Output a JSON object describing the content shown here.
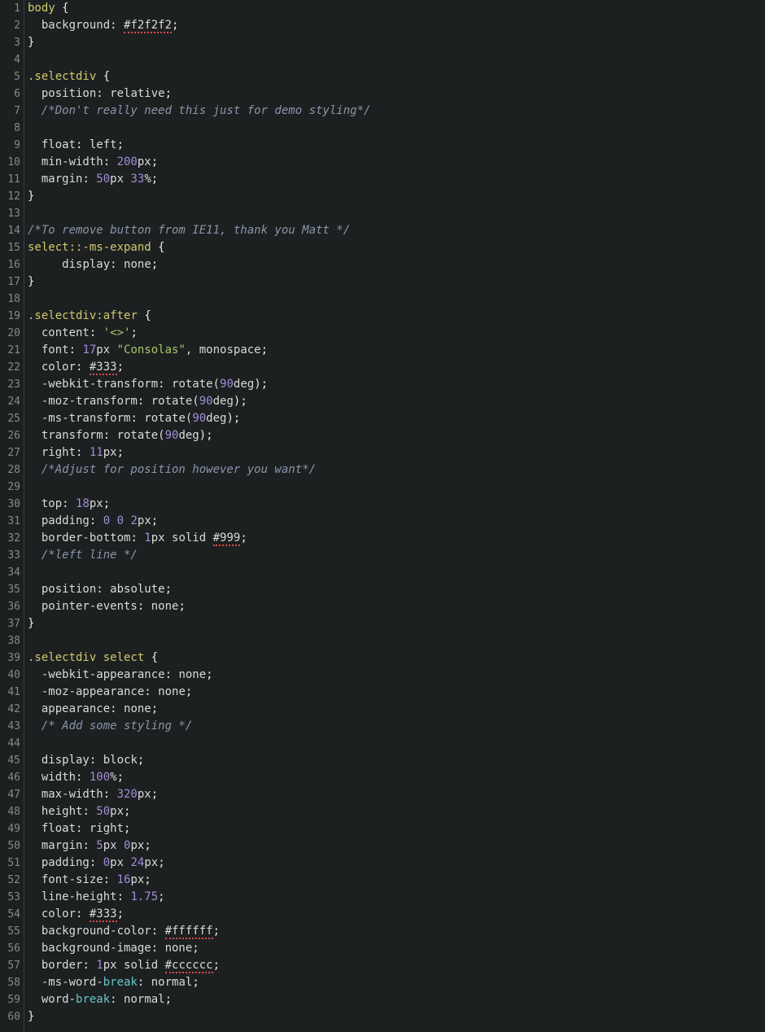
{
  "lines": [
    {
      "n": 1,
      "tokens": [
        {
          "t": "body ",
          "c": "sel"
        },
        {
          "t": "{",
          "c": "brace"
        }
      ]
    },
    {
      "n": 2,
      "tokens": [
        {
          "t": "  ",
          "c": ""
        },
        {
          "t": "background",
          "c": "prop"
        },
        {
          "t": ": ",
          "c": "punct"
        },
        {
          "t": "#f2f2f2",
          "c": "val",
          "u": true
        },
        {
          "t": ";",
          "c": "punct"
        }
      ]
    },
    {
      "n": 3,
      "tokens": [
        {
          "t": "}",
          "c": "brace"
        }
      ]
    },
    {
      "n": 4,
      "tokens": []
    },
    {
      "n": 5,
      "tokens": [
        {
          "t": ".selectdiv ",
          "c": "sel"
        },
        {
          "t": "{",
          "c": "brace"
        }
      ]
    },
    {
      "n": 6,
      "tokens": [
        {
          "t": "  ",
          "c": ""
        },
        {
          "t": "position",
          "c": "prop"
        },
        {
          "t": ": ",
          "c": "punct"
        },
        {
          "t": "relative",
          "c": "val"
        },
        {
          "t": ";",
          "c": "punct"
        }
      ]
    },
    {
      "n": 7,
      "tokens": [
        {
          "t": "  ",
          "c": ""
        },
        {
          "t": "/*Don't really need this just for demo styling*/",
          "c": "comment"
        }
      ]
    },
    {
      "n": 8,
      "tokens": [
        {
          "t": "  ",
          "c": ""
        }
      ]
    },
    {
      "n": 9,
      "tokens": [
        {
          "t": "  ",
          "c": ""
        },
        {
          "t": "float",
          "c": "prop"
        },
        {
          "t": ": ",
          "c": "punct"
        },
        {
          "t": "left",
          "c": "val"
        },
        {
          "t": ";",
          "c": "punct"
        }
      ]
    },
    {
      "n": 10,
      "tokens": [
        {
          "t": "  ",
          "c": ""
        },
        {
          "t": "min-width",
          "c": "prop"
        },
        {
          "t": ": ",
          "c": "punct"
        },
        {
          "t": "200",
          "c": "num"
        },
        {
          "t": "px",
          "c": "unit"
        },
        {
          "t": ";",
          "c": "punct"
        }
      ]
    },
    {
      "n": 11,
      "tokens": [
        {
          "t": "  ",
          "c": ""
        },
        {
          "t": "margin",
          "c": "prop"
        },
        {
          "t": ": ",
          "c": "punct"
        },
        {
          "t": "50",
          "c": "num"
        },
        {
          "t": "px ",
          "c": "unit"
        },
        {
          "t": "33",
          "c": "num"
        },
        {
          "t": "%",
          "c": "unit"
        },
        {
          "t": ";",
          "c": "punct"
        }
      ]
    },
    {
      "n": 12,
      "tokens": [
        {
          "t": "}",
          "c": "brace"
        }
      ]
    },
    {
      "n": 13,
      "tokens": []
    },
    {
      "n": 14,
      "tokens": [
        {
          "t": "/*To remove button from IE11, thank you Matt */",
          "c": "comment"
        }
      ]
    },
    {
      "n": 15,
      "tokens": [
        {
          "t": "select",
          "c": "sel"
        },
        {
          "t": "::-ms-expand ",
          "c": "sel"
        },
        {
          "t": "{",
          "c": "brace"
        }
      ]
    },
    {
      "n": 16,
      "tokens": [
        {
          "t": "     ",
          "c": ""
        },
        {
          "t": "display",
          "c": "prop"
        },
        {
          "t": ": ",
          "c": "punct"
        },
        {
          "t": "none",
          "c": "val"
        },
        {
          "t": ";",
          "c": "punct"
        }
      ]
    },
    {
      "n": 17,
      "tokens": [
        {
          "t": "}",
          "c": "brace"
        }
      ]
    },
    {
      "n": 18,
      "tokens": []
    },
    {
      "n": 19,
      "tokens": [
        {
          "t": ".selectdiv",
          "c": "sel"
        },
        {
          "t": ":after ",
          "c": "sel"
        },
        {
          "t": "{",
          "c": "brace"
        }
      ]
    },
    {
      "n": 20,
      "tokens": [
        {
          "t": "  ",
          "c": ""
        },
        {
          "t": "content",
          "c": "prop"
        },
        {
          "t": ": ",
          "c": "punct"
        },
        {
          "t": "'<>'",
          "c": "str"
        },
        {
          "t": ";",
          "c": "punct"
        }
      ]
    },
    {
      "n": 21,
      "tokens": [
        {
          "t": "  ",
          "c": ""
        },
        {
          "t": "font",
          "c": "prop"
        },
        {
          "t": ": ",
          "c": "punct"
        },
        {
          "t": "17",
          "c": "num"
        },
        {
          "t": "px ",
          "c": "unit"
        },
        {
          "t": "\"Consolas\"",
          "c": "str"
        },
        {
          "t": ", monospace",
          "c": "val"
        },
        {
          "t": ";",
          "c": "punct"
        }
      ]
    },
    {
      "n": 22,
      "tokens": [
        {
          "t": "  ",
          "c": ""
        },
        {
          "t": "color",
          "c": "prop"
        },
        {
          "t": ": ",
          "c": "punct"
        },
        {
          "t": "#333",
          "c": "val",
          "u": true
        },
        {
          "t": ";",
          "c": "punct"
        }
      ]
    },
    {
      "n": 23,
      "tokens": [
        {
          "t": "  ",
          "c": ""
        },
        {
          "t": "-webkit-transform",
          "c": "prop"
        },
        {
          "t": ": ",
          "c": "punct"
        },
        {
          "t": "rotate(",
          "c": "val"
        },
        {
          "t": "90",
          "c": "num"
        },
        {
          "t": "deg",
          "c": "unit"
        },
        {
          "t": ");",
          "c": "punct"
        }
      ]
    },
    {
      "n": 24,
      "tokens": [
        {
          "t": "  ",
          "c": ""
        },
        {
          "t": "-moz-transform",
          "c": "prop"
        },
        {
          "t": ": ",
          "c": "punct"
        },
        {
          "t": "rotate(",
          "c": "val"
        },
        {
          "t": "90",
          "c": "num"
        },
        {
          "t": "deg",
          "c": "unit"
        },
        {
          "t": ");",
          "c": "punct"
        }
      ]
    },
    {
      "n": 25,
      "tokens": [
        {
          "t": "  ",
          "c": ""
        },
        {
          "t": "-ms-transform",
          "c": "prop"
        },
        {
          "t": ": ",
          "c": "punct"
        },
        {
          "t": "rotate(",
          "c": "val"
        },
        {
          "t": "90",
          "c": "num"
        },
        {
          "t": "deg",
          "c": "unit"
        },
        {
          "t": ");",
          "c": "punct"
        }
      ]
    },
    {
      "n": 26,
      "tokens": [
        {
          "t": "  ",
          "c": ""
        },
        {
          "t": "transform",
          "c": "prop"
        },
        {
          "t": ": ",
          "c": "punct"
        },
        {
          "t": "rotate(",
          "c": "val"
        },
        {
          "t": "90",
          "c": "num"
        },
        {
          "t": "deg",
          "c": "unit"
        },
        {
          "t": ");",
          "c": "punct"
        }
      ]
    },
    {
      "n": 27,
      "tokens": [
        {
          "t": "  ",
          "c": ""
        },
        {
          "t": "right",
          "c": "prop"
        },
        {
          "t": ": ",
          "c": "punct"
        },
        {
          "t": "11",
          "c": "num"
        },
        {
          "t": "px",
          "c": "unit"
        },
        {
          "t": ";",
          "c": "punct"
        }
      ]
    },
    {
      "n": 28,
      "tokens": [
        {
          "t": "  ",
          "c": ""
        },
        {
          "t": "/*Adjust for position however you want*/",
          "c": "comment"
        }
      ]
    },
    {
      "n": 29,
      "tokens": [
        {
          "t": "  ",
          "c": ""
        }
      ]
    },
    {
      "n": 30,
      "tokens": [
        {
          "t": "  ",
          "c": ""
        },
        {
          "t": "top",
          "c": "prop"
        },
        {
          "t": ": ",
          "c": "punct"
        },
        {
          "t": "18",
          "c": "num"
        },
        {
          "t": "px",
          "c": "unit"
        },
        {
          "t": ";",
          "c": "punct"
        }
      ]
    },
    {
      "n": 31,
      "tokens": [
        {
          "t": "  ",
          "c": ""
        },
        {
          "t": "padding",
          "c": "prop"
        },
        {
          "t": ": ",
          "c": "punct"
        },
        {
          "t": "0",
          "c": "num"
        },
        {
          "t": " ",
          "c": ""
        },
        {
          "t": "0",
          "c": "num"
        },
        {
          "t": " ",
          "c": ""
        },
        {
          "t": "2",
          "c": "num"
        },
        {
          "t": "px",
          "c": "unit"
        },
        {
          "t": ";",
          "c": "punct"
        }
      ]
    },
    {
      "n": 32,
      "tokens": [
        {
          "t": "  ",
          "c": ""
        },
        {
          "t": "border-bottom",
          "c": "prop"
        },
        {
          "t": ": ",
          "c": "punct"
        },
        {
          "t": "1",
          "c": "num"
        },
        {
          "t": "px solid ",
          "c": "val"
        },
        {
          "t": "#999",
          "c": "val",
          "u": true
        },
        {
          "t": ";",
          "c": "punct"
        }
      ]
    },
    {
      "n": 33,
      "tokens": [
        {
          "t": "  ",
          "c": ""
        },
        {
          "t": "/*left line */",
          "c": "comment"
        }
      ]
    },
    {
      "n": 34,
      "tokens": [
        {
          "t": "  ",
          "c": ""
        }
      ]
    },
    {
      "n": 35,
      "tokens": [
        {
          "t": "  ",
          "c": ""
        },
        {
          "t": "position",
          "c": "prop"
        },
        {
          "t": ": ",
          "c": "punct"
        },
        {
          "t": "absolute",
          "c": "val"
        },
        {
          "t": ";",
          "c": "punct"
        }
      ]
    },
    {
      "n": 36,
      "tokens": [
        {
          "t": "  ",
          "c": ""
        },
        {
          "t": "pointer-events",
          "c": "prop"
        },
        {
          "t": ": ",
          "c": "punct"
        },
        {
          "t": "none",
          "c": "val"
        },
        {
          "t": ";",
          "c": "punct"
        }
      ]
    },
    {
      "n": 37,
      "tokens": [
        {
          "t": "}",
          "c": "brace"
        }
      ]
    },
    {
      "n": 38,
      "tokens": []
    },
    {
      "n": 39,
      "tokens": [
        {
          "t": ".selectdiv select ",
          "c": "sel"
        },
        {
          "t": "{",
          "c": "brace"
        }
      ]
    },
    {
      "n": 40,
      "tokens": [
        {
          "t": "  ",
          "c": ""
        },
        {
          "t": "-webkit-appearance",
          "c": "prop"
        },
        {
          "t": ": ",
          "c": "punct"
        },
        {
          "t": "none",
          "c": "val"
        },
        {
          "t": ";",
          "c": "punct"
        }
      ]
    },
    {
      "n": 41,
      "tokens": [
        {
          "t": "  ",
          "c": ""
        },
        {
          "t": "-moz-appearance",
          "c": "prop"
        },
        {
          "t": ": ",
          "c": "punct"
        },
        {
          "t": "none",
          "c": "val"
        },
        {
          "t": ";",
          "c": "punct"
        }
      ]
    },
    {
      "n": 42,
      "tokens": [
        {
          "t": "  ",
          "c": ""
        },
        {
          "t": "appearance",
          "c": "prop"
        },
        {
          "t": ": ",
          "c": "punct"
        },
        {
          "t": "none",
          "c": "val"
        },
        {
          "t": ";",
          "c": "punct"
        }
      ]
    },
    {
      "n": 43,
      "tokens": [
        {
          "t": "  ",
          "c": ""
        },
        {
          "t": "/* Add some styling */",
          "c": "comment"
        }
      ]
    },
    {
      "n": 44,
      "tokens": [
        {
          "t": "  ",
          "c": ""
        }
      ]
    },
    {
      "n": 45,
      "tokens": [
        {
          "t": "  ",
          "c": ""
        },
        {
          "t": "display",
          "c": "prop"
        },
        {
          "t": ": ",
          "c": "punct"
        },
        {
          "t": "block",
          "c": "val"
        },
        {
          "t": ";",
          "c": "punct"
        }
      ]
    },
    {
      "n": 46,
      "tokens": [
        {
          "t": "  ",
          "c": ""
        },
        {
          "t": "width",
          "c": "prop"
        },
        {
          "t": ": ",
          "c": "punct"
        },
        {
          "t": "100",
          "c": "num"
        },
        {
          "t": "%",
          "c": "unit"
        },
        {
          "t": ";",
          "c": "punct"
        }
      ]
    },
    {
      "n": 47,
      "tokens": [
        {
          "t": "  ",
          "c": ""
        },
        {
          "t": "max-width",
          "c": "prop"
        },
        {
          "t": ": ",
          "c": "punct"
        },
        {
          "t": "320",
          "c": "num"
        },
        {
          "t": "px",
          "c": "unit"
        },
        {
          "t": ";",
          "c": "punct"
        }
      ]
    },
    {
      "n": 48,
      "tokens": [
        {
          "t": "  ",
          "c": ""
        },
        {
          "t": "height",
          "c": "prop"
        },
        {
          "t": ": ",
          "c": "punct"
        },
        {
          "t": "50",
          "c": "num"
        },
        {
          "t": "px",
          "c": "unit"
        },
        {
          "t": ";",
          "c": "punct"
        }
      ]
    },
    {
      "n": 49,
      "tokens": [
        {
          "t": "  ",
          "c": ""
        },
        {
          "t": "float",
          "c": "prop"
        },
        {
          "t": ": ",
          "c": "punct"
        },
        {
          "t": "right",
          "c": "val"
        },
        {
          "t": ";",
          "c": "punct"
        }
      ]
    },
    {
      "n": 50,
      "tokens": [
        {
          "t": "  ",
          "c": ""
        },
        {
          "t": "margin",
          "c": "prop"
        },
        {
          "t": ": ",
          "c": "punct"
        },
        {
          "t": "5",
          "c": "num"
        },
        {
          "t": "px ",
          "c": "unit"
        },
        {
          "t": "0",
          "c": "num"
        },
        {
          "t": "px",
          "c": "unit"
        },
        {
          "t": ";",
          "c": "punct"
        }
      ]
    },
    {
      "n": 51,
      "tokens": [
        {
          "t": "  ",
          "c": ""
        },
        {
          "t": "padding",
          "c": "prop"
        },
        {
          "t": ": ",
          "c": "punct"
        },
        {
          "t": "0",
          "c": "num"
        },
        {
          "t": "px ",
          "c": "unit"
        },
        {
          "t": "24",
          "c": "num"
        },
        {
          "t": "px",
          "c": "unit"
        },
        {
          "t": ";",
          "c": "punct"
        }
      ]
    },
    {
      "n": 52,
      "tokens": [
        {
          "t": "  ",
          "c": ""
        },
        {
          "t": "font-size",
          "c": "prop"
        },
        {
          "t": ": ",
          "c": "punct"
        },
        {
          "t": "16",
          "c": "num"
        },
        {
          "t": "px",
          "c": "unit"
        },
        {
          "t": ";",
          "c": "punct"
        }
      ]
    },
    {
      "n": 53,
      "tokens": [
        {
          "t": "  ",
          "c": ""
        },
        {
          "t": "line-height",
          "c": "prop"
        },
        {
          "t": ": ",
          "c": "punct"
        },
        {
          "t": "1.75",
          "c": "num"
        },
        {
          "t": ";",
          "c": "punct"
        }
      ]
    },
    {
      "n": 54,
      "tokens": [
        {
          "t": "  ",
          "c": ""
        },
        {
          "t": "color",
          "c": "prop"
        },
        {
          "t": ": ",
          "c": "punct"
        },
        {
          "t": "#333",
          "c": "val",
          "u": true
        },
        {
          "t": ";",
          "c": "punct"
        }
      ]
    },
    {
      "n": 55,
      "tokens": [
        {
          "t": "  ",
          "c": ""
        },
        {
          "t": "background-color",
          "c": "prop"
        },
        {
          "t": ": ",
          "c": "punct"
        },
        {
          "t": "#ffffff",
          "c": "val",
          "u": true
        },
        {
          "t": ";",
          "c": "punct"
        }
      ]
    },
    {
      "n": 56,
      "tokens": [
        {
          "t": "  ",
          "c": ""
        },
        {
          "t": "background-image",
          "c": "prop"
        },
        {
          "t": ": ",
          "c": "punct"
        },
        {
          "t": "none",
          "c": "val"
        },
        {
          "t": ";",
          "c": "punct"
        }
      ]
    },
    {
      "n": 57,
      "tokens": [
        {
          "t": "  ",
          "c": ""
        },
        {
          "t": "border",
          "c": "prop"
        },
        {
          "t": ": ",
          "c": "punct"
        },
        {
          "t": "1",
          "c": "num"
        },
        {
          "t": "px solid ",
          "c": "val"
        },
        {
          "t": "#cccccc",
          "c": "val",
          "u": true
        },
        {
          "t": ";",
          "c": "punct"
        }
      ]
    },
    {
      "n": 58,
      "tokens": [
        {
          "t": "  ",
          "c": ""
        },
        {
          "t": "-ms-word-",
          "c": "prop"
        },
        {
          "t": "break",
          "c": "word-break"
        },
        {
          "t": ": ",
          "c": "punct"
        },
        {
          "t": "normal",
          "c": "val"
        },
        {
          "t": ";",
          "c": "punct"
        }
      ]
    },
    {
      "n": 59,
      "tokens": [
        {
          "t": "  ",
          "c": ""
        },
        {
          "t": "word-",
          "c": "prop"
        },
        {
          "t": "break",
          "c": "word-break"
        },
        {
          "t": ": ",
          "c": "punct"
        },
        {
          "t": "normal",
          "c": "val"
        },
        {
          "t": ";",
          "c": "punct"
        }
      ]
    },
    {
      "n": 60,
      "tokens": [
        {
          "t": "}",
          "c": "brace"
        }
      ]
    }
  ]
}
